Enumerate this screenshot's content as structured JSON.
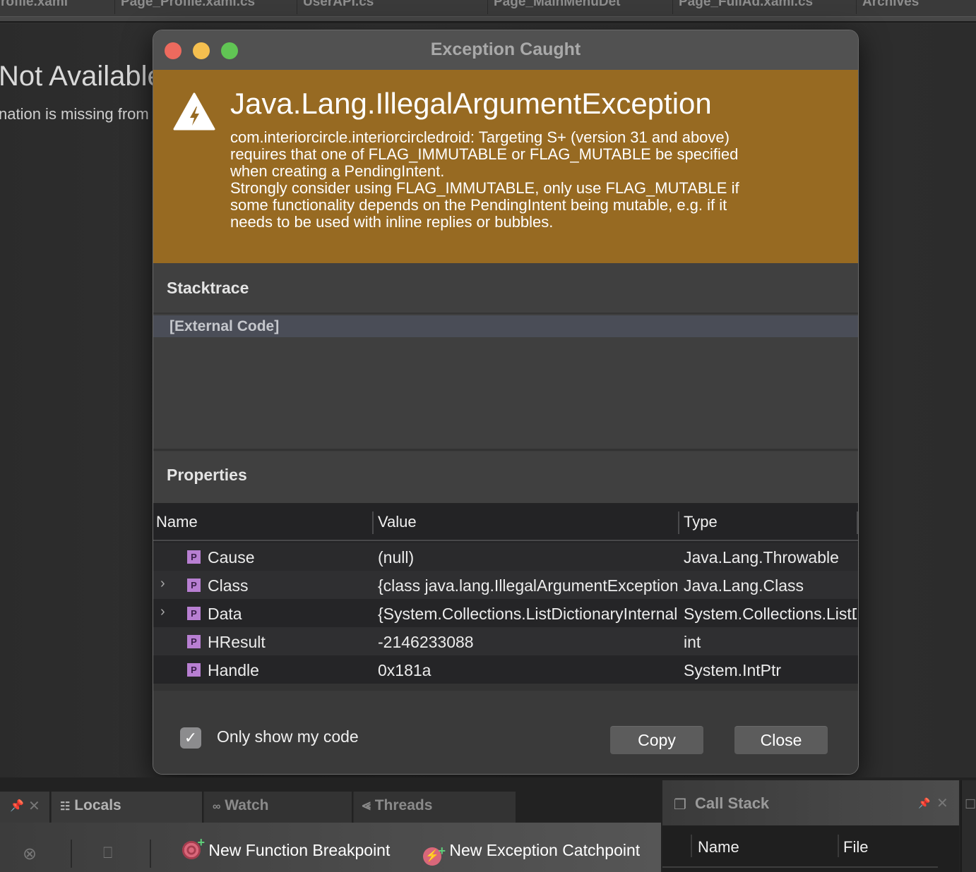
{
  "editor_tabs": [
    "rofile.xaml",
    "Page_Profile.xaml.cs",
    "UserAPI.cs",
    "Page_MainMenuDet",
    "Page_FullAd.xaml.cs",
    "Archives"
  ],
  "background": {
    "title": "Not Available",
    "subtitle": "nation is missing from"
  },
  "dialog": {
    "title": "Exception Caught",
    "exception_name": "Java.Lang.IllegalArgumentException",
    "exception_message": "com.interiorcircle.interiorcircledroid: Targeting S+ (version 31 and above)\nrequires that one of FLAG_IMMUTABLE or FLAG_MUTABLE be specified\nwhen creating a PendingIntent.\nStrongly consider using FLAG_IMMUTABLE, only use FLAG_MUTABLE if\nsome functionality depends on the PendingIntent being mutable, e.g. if it\nneeds to be used with inline replies or bubbles.",
    "banner_color": "#976a22",
    "stacktrace": {
      "label": "Stacktrace",
      "frames": [
        "[External Code]"
      ]
    },
    "properties": {
      "label": "Properties",
      "columns": [
        "Name",
        "Value",
        "Type"
      ],
      "badge": "P",
      "rows": [
        {
          "name": "Cause",
          "value": "(null)",
          "type": "Java.Lang.Throwable",
          "expandable": false
        },
        {
          "name": "Class",
          "value": "{class java.lang.IllegalArgumentException}",
          "type": "Java.Lang.Class",
          "expandable": true
        },
        {
          "name": "Data",
          "value": "{System.Collections.ListDictionaryInternal}",
          "type": "System.Collections.ListDictionaryInternal",
          "expandable": true
        },
        {
          "name": "HResult",
          "value": "-2146233088",
          "type": "int",
          "expandable": false
        },
        {
          "name": "Handle",
          "value": "0x181a",
          "type": "System.IntPtr",
          "expandable": false
        }
      ]
    },
    "only_show_my_code": {
      "label": "Only show my code",
      "checked": true
    },
    "buttons": {
      "copy": "Copy",
      "close": "Close"
    }
  },
  "bottom_panel": {
    "tabs": [
      {
        "label": "Locals",
        "icon": "locals-icon"
      },
      {
        "label": "Watch",
        "icon": "watch-icon"
      },
      {
        "label": "Threads",
        "icon": "threads-icon"
      }
    ],
    "toolbar": {
      "new_function_breakpoint": "New Function Breakpoint",
      "new_exception_catchpoint": "New Exception Catchpoint"
    },
    "call_stack": {
      "title": "Call Stack",
      "columns": [
        "Name",
        "File"
      ]
    }
  }
}
